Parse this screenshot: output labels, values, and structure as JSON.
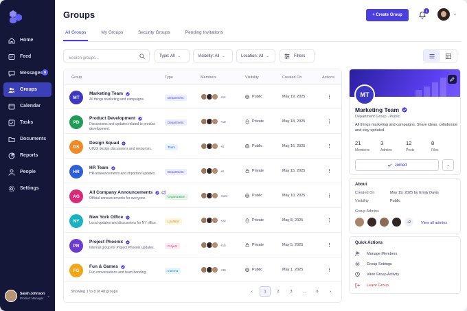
{
  "sidebar": {
    "items": [
      {
        "label": "Home",
        "icon": "home-icon"
      },
      {
        "label": "Feed",
        "icon": "feed-icon"
      },
      {
        "label": "Messages",
        "icon": "messages-icon",
        "badge": "8"
      },
      {
        "label": "Groups",
        "icon": "groups-icon",
        "active": true
      },
      {
        "label": "Calendar",
        "icon": "calendar-icon"
      },
      {
        "label": "Tasks",
        "icon": "tasks-icon"
      },
      {
        "label": "Documents",
        "icon": "documents-icon"
      },
      {
        "label": "Reports",
        "icon": "reports-icon"
      },
      {
        "label": "People",
        "icon": "people-icon"
      },
      {
        "label": "Settings",
        "icon": "settings-icon"
      }
    ],
    "user": {
      "name": "Sarah Johnson",
      "role": "Product Manager"
    }
  },
  "header": {
    "title": "Groups",
    "create_label": "+ Create Group",
    "notification_count": "5"
  },
  "tabs": [
    {
      "label": "All Groups",
      "active": true
    },
    {
      "label": "My Groups"
    },
    {
      "label": "Security Groups"
    },
    {
      "label": "Pending Invitations"
    }
  ],
  "filters": {
    "search_placeholder": "Search groups...",
    "type": "Type: All",
    "visibility": "Visibility: All",
    "location": "Location: All",
    "filters_label": "Filters"
  },
  "table": {
    "headers": [
      "Group",
      "Type",
      "Members",
      "Visibility",
      "Created On",
      "Actions"
    ],
    "rows": [
      {
        "initials": "MT",
        "color": "#3d38c4",
        "name": "Marketing Team",
        "desc": "All things marketing and campaigns.",
        "type": "Department",
        "more": "+12",
        "visibility": "Public",
        "created": "May 19, 2025"
      },
      {
        "initials": "PD",
        "color": "#1f9d55",
        "name": "Product Development",
        "desc": "Discussions and updates related to product development.",
        "type": "Department",
        "more": "+18",
        "visibility": "Private",
        "created": "May 18, 2025"
      },
      {
        "initials": "DS",
        "color": "#f08a24",
        "name": "Design Squad",
        "desc": "UI/UX design discussions and resources.",
        "type": "Team",
        "more": "+8",
        "visibility": "Public",
        "created": "May 16, 2025"
      },
      {
        "initials": "HR",
        "color": "#2d5fd8",
        "name": "HR Team",
        "desc": "HR announcements and important updates.",
        "type": "Department",
        "more": "+6",
        "visibility": "Private",
        "created": "May 15, 2025"
      },
      {
        "initials": "AG",
        "color": "#d92a7a",
        "name": "All Company Announcements",
        "desc": "Official announcements for everyone.",
        "type": "Organization",
        "more": "+124",
        "visibility": "Public",
        "created": "May 10, 2025"
      },
      {
        "initials": "NY",
        "color": "#17b3c4",
        "name": "New York Office",
        "desc": "Local updates and discussions for NY office.",
        "type": "Location",
        "more": "+23",
        "visibility": "Private",
        "created": "May 8, 2025"
      },
      {
        "initials": "PR",
        "color": "#6c3bd1",
        "name": "Project Phoenix",
        "desc": "Internal group for Project Phoenix updates.",
        "type": "Project",
        "more": "+15",
        "visibility": "Private",
        "created": "May 5, 2025"
      },
      {
        "initials": "FG",
        "color": "#f2a516",
        "name": "Fun & Games",
        "desc": "Fun conversations and team bonding.",
        "type": "Interest",
        "more": "+30",
        "visibility": "Public",
        "created": "May 1, 2025"
      }
    ],
    "showing": "Showing 1 to 8 of 48 groups",
    "pages": [
      "1",
      "2",
      "3",
      "...",
      "6"
    ]
  },
  "detail": {
    "initials": "MT",
    "title": "Marketing Team",
    "subtitle": "Department Group  ·  Public",
    "desc": "All things marketing and campaigns. Share ideas, collaborate and stay updated.",
    "stats": [
      {
        "num": "21",
        "label": "Members"
      },
      {
        "num": "3",
        "label": "Admins"
      },
      {
        "num": "12",
        "label": "Posts"
      },
      {
        "num": "8",
        "label": "Files"
      }
    ],
    "joined_label": "Joined"
  },
  "about": {
    "title": "About",
    "created_key": "Created On",
    "created_val": "May 19, 2025 by Emily Davis",
    "visibility_key": "Visibility",
    "visibility_val": "Public",
    "admins_key": "Group Admins",
    "admins_more": "+2",
    "view_all": "View all admins"
  },
  "quick_actions": {
    "title": "Quick Actions",
    "items": [
      "Manage Members",
      "Group Settings",
      "View Group Activity",
      "Leave Group"
    ]
  }
}
